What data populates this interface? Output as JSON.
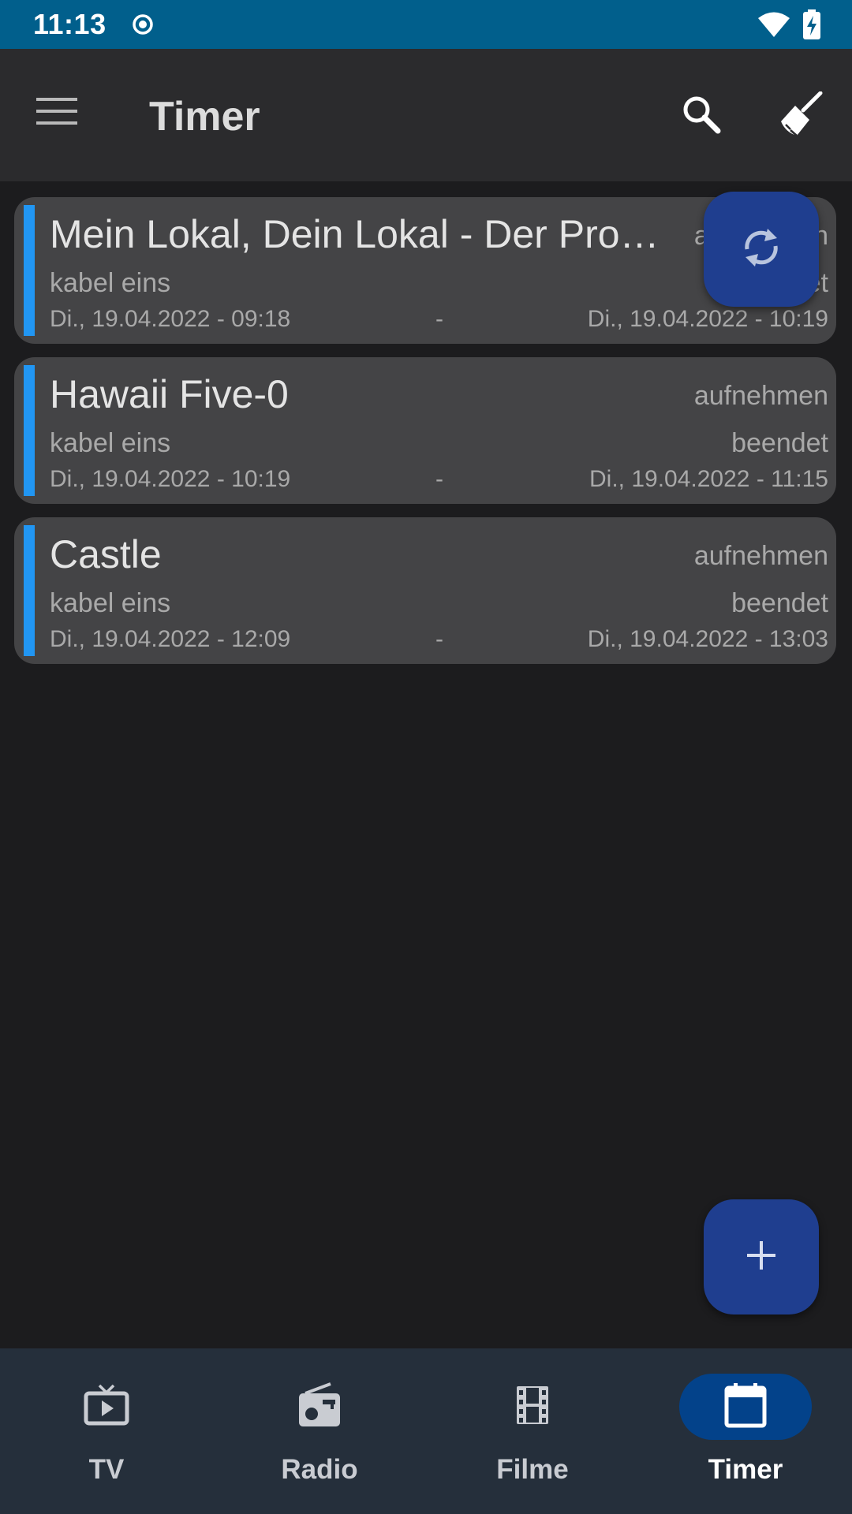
{
  "status_bar": {
    "time": "11:13",
    "background": "#015f8c"
  },
  "app_bar": {
    "title": "Timer",
    "icons": [
      "menu-icon",
      "search-icon",
      "broom-icon"
    ]
  },
  "timers": [
    {
      "title": "Mein Lokal, Dein Lokal - Der Pro…",
      "action": "aufnehmen",
      "channel": "kabel eins",
      "status": "beendet",
      "start": "Di., 19.04.2022 - 09:18",
      "separator": "-",
      "end": "Di., 19.04.2022 - 10:19"
    },
    {
      "title": "Hawaii Five-0",
      "action": "aufnehmen",
      "channel": "kabel eins",
      "status": "beendet",
      "start": "Di., 19.04.2022 - 10:19",
      "separator": "-",
      "end": "Di., 19.04.2022 - 11:15"
    },
    {
      "title": "Castle",
      "action": "aufnehmen",
      "channel": "kabel eins",
      "status": "beendet",
      "start": "Di., 19.04.2022 - 12:09",
      "separator": "-",
      "end": "Di., 19.04.2022 - 13:03"
    }
  ],
  "fabs": {
    "refresh_icon": "refresh-icon",
    "add_icon": "plus-icon"
  },
  "bottom_nav": {
    "items": [
      {
        "label": "TV",
        "icon": "tv-icon",
        "active": false
      },
      {
        "label": "Radio",
        "icon": "radio-icon",
        "active": false
      },
      {
        "label": "Filme",
        "icon": "film-icon",
        "active": false
      },
      {
        "label": "Timer",
        "icon": "calendar-icon",
        "active": true
      }
    ]
  },
  "colors": {
    "accent": "#2196f3",
    "fab": "#1f3e8f",
    "nav_active": "#03428a",
    "nav_background": "#252f3b",
    "card": "#444446",
    "background": "#1c1c1e"
  }
}
